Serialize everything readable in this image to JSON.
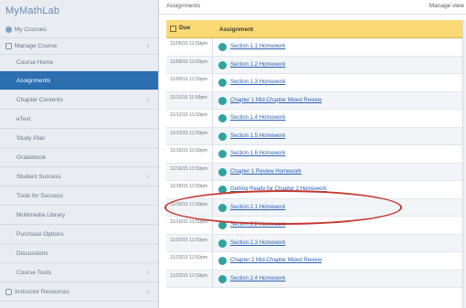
{
  "app_title": "MyMathLab",
  "header": {
    "title": "Assignments",
    "manage_label": "Manage view"
  },
  "sidebar": {
    "items": [
      {
        "label": "My Courses",
        "icon": "dot-icon"
      },
      {
        "label": "Manage Course",
        "icon": "home-icon"
      },
      {
        "label": "Course Home"
      },
      {
        "label": "Assignments",
        "active": true
      },
      {
        "label": "Chapter Contents"
      },
      {
        "label": "eText"
      },
      {
        "label": "Study Plan"
      },
      {
        "label": "Gradebook"
      },
      {
        "label": "Student Success"
      },
      {
        "label": "Tools for Success"
      },
      {
        "label": "Multimedia Library"
      },
      {
        "label": "Purchase Options"
      },
      {
        "label": "Discussions"
      },
      {
        "label": "Course Tools"
      },
      {
        "label": "Instructor Resources",
        "icon": "resources-icon"
      }
    ]
  },
  "table": {
    "headers": {
      "due": "Due",
      "assignment": "Assignment"
    },
    "rows": [
      {
        "date": "11/09/15 11:59pm",
        "title": "Section 1.1 Homework"
      },
      {
        "date": "11/09/15 11:59pm",
        "title": "Section 1.2 Homework"
      },
      {
        "date": "11/09/15 11:59pm",
        "title": "Section 1.3 Homework"
      },
      {
        "date": "11/11/15 11:59pm",
        "title": "Chapter 1 Mid-Chapter Mixed Review"
      },
      {
        "date": "11/12/15 11:59pm",
        "title": "Section 1.4 Homework"
      },
      {
        "date": "11/13/15 11:59pm",
        "title": "Section 1.5 Homework"
      },
      {
        "date": "11/16/15 11:59pm",
        "title": "Section 1.6 Homework"
      },
      {
        "date": "11/16/15 11:59pm",
        "title": "Chapter 1 Review Homework"
      },
      {
        "date": "11/18/15 11:59pm",
        "title": "Getting Ready for Chapter 2 Homework"
      },
      {
        "date": "11/19/15 11:59pm",
        "title": "Section 2.1 Homework"
      },
      {
        "date": "11/19/15 11:59pm",
        "title": "Section 2.2 Homework"
      },
      {
        "date": "11/20/15 11:59pm",
        "title": "Section 2.3 Homework"
      },
      {
        "date": "11/23/15 11:59pm",
        "title": "Chapter 2 Mid-Chapter Mixed Review"
      },
      {
        "date": "11/23/15 11:59pm",
        "title": "Section 2.4 Homework"
      }
    ]
  },
  "colors": {
    "accent": "#2b6fb1",
    "header_bg": "#fbd975",
    "link": "#2a5fb3",
    "highlight": "#c4362f"
  }
}
